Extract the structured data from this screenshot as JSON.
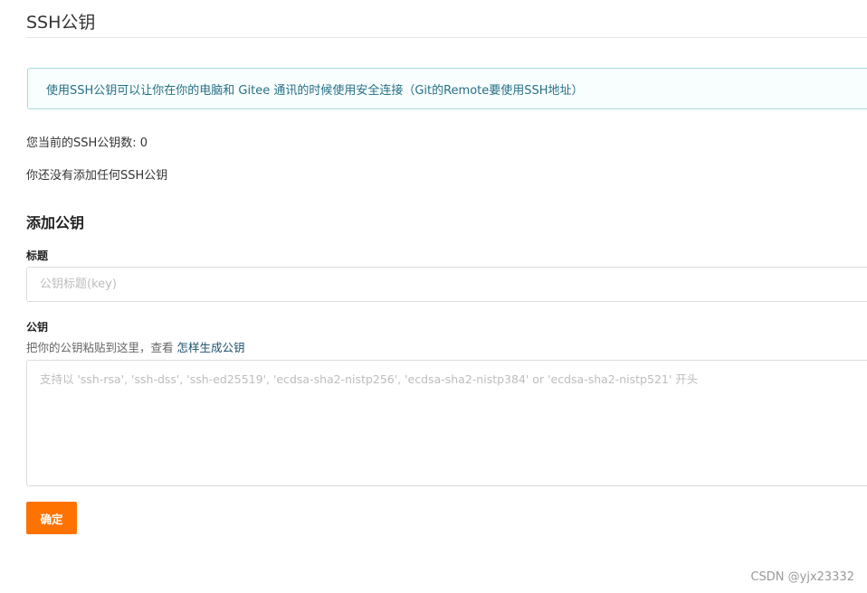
{
  "header": {
    "title": "SSH公钥"
  },
  "info": {
    "message": "使用SSH公钥可以让你在你的电脑和 Gitee 通讯的时候使用安全连接（Git的Remote要使用SSH地址）"
  },
  "status": {
    "count_label": "您当前的SSH公钥数: ",
    "count_value": "0",
    "empty_message": "你还没有添加任何SSH公钥"
  },
  "form": {
    "section_title": "添加公钥",
    "title_label": "标题",
    "title_placeholder": "公钥标题(key)",
    "title_value": "",
    "key_label": "公钥",
    "key_hint_prefix": "把你的公钥粘贴到这里，查看 ",
    "key_hint_link": "怎样生成公钥",
    "key_placeholder": "支持以 'ssh-rsa', 'ssh-dss', 'ssh-ed25519', 'ecdsa-sha2-nistp256', 'ecdsa-sha2-nistp384' or 'ecdsa-sha2-nistp521' 开头",
    "key_value": "",
    "submit_label": "确定"
  },
  "watermark": {
    "text": "CSDN @yjx23332"
  },
  "colors": {
    "accent": "#fe7300",
    "info_border": "#a9d9dd",
    "info_text": "#276f86",
    "link": "#1a4f6e"
  }
}
